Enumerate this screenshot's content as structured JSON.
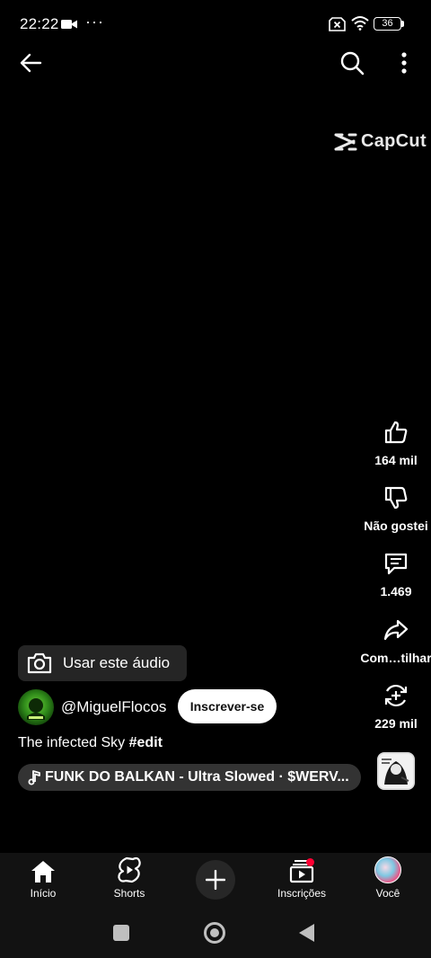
{
  "status_bar": {
    "time": "22:22",
    "dots": "···",
    "battery_level": "36"
  },
  "watermark": {
    "text": "CapCut"
  },
  "actions": {
    "like_count": "164 mil",
    "dislike_label": "Não gostei",
    "comment_count": "1.469",
    "share_label": "Com…tilhar",
    "remix_count": "229 mil"
  },
  "video": {
    "use_audio_label": "Usar este áudio",
    "channel_name": "@MiguelFlocos",
    "subscribe_label": "Inscrever-se",
    "title": "The infected Sky ",
    "title_hashtag": "#edit",
    "music": "FUNK DO BALKAN - Ultra Slowed · $WERV..."
  },
  "bottom_nav": {
    "home": "Início",
    "shorts": "Shorts",
    "subscriptions": "Inscrições",
    "you": "Você"
  },
  "colors": {
    "background": "#000000",
    "nav_background": "#121212",
    "accent_red": "#ff0033",
    "subscribe_bg": "#ffffff"
  },
  "icons": [
    "back-arrow-icon",
    "search-icon",
    "more-vert-icon",
    "capcut-logo-icon",
    "thumb-up-icon",
    "thumb-down-icon",
    "comment-icon",
    "share-icon",
    "remix-icon",
    "camera-icon",
    "music-note-icon",
    "home-icon",
    "shorts-icon",
    "plus-icon",
    "subscriptions-icon"
  ]
}
